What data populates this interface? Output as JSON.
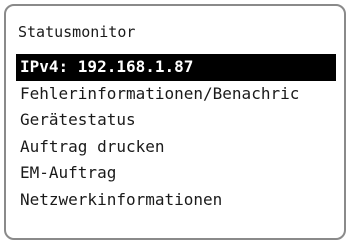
{
  "screen": {
    "title": "Statusmonitor"
  },
  "menu": {
    "items": [
      {
        "label": "IPv4: 192.168.1.87",
        "selected": true
      },
      {
        "label": "Fehlerinformationen/Benachric",
        "selected": false
      },
      {
        "label": "Gerätestatus",
        "selected": false
      },
      {
        "label": "Auftrag drucken",
        "selected": false
      },
      {
        "label": "EM-Auftrag",
        "selected": false
      },
      {
        "label": "Netzwerkinformationen",
        "selected": false
      }
    ]
  },
  "colors": {
    "selection_background": "#000000",
    "selection_text": "#ffffff",
    "frame_border": "#8a8a8a"
  }
}
